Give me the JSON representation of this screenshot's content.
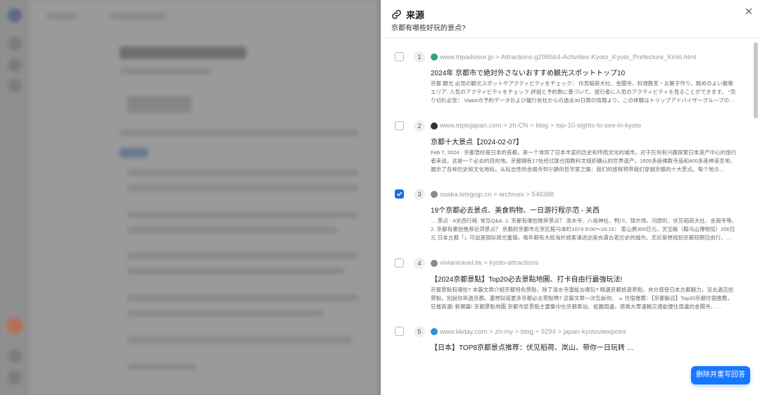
{
  "panel": {
    "title": "来源",
    "subtitle": "京都有哪些好玩的景点?",
    "delete_button": "删除并重写回答"
  },
  "sources": [
    {
      "index": "1",
      "checked": false,
      "favicon": "tripadvisor-icon",
      "favicon_color": "#34a374",
      "url": "www.tripadvisor.jp > Attractions-g298564-Activities-Kyoto_Kyoto_Prefecture_Kinki.html",
      "title": "2024年 京都市で絶対外さないおすすめ観光スポットトップ10",
      "snippet": "京都 観光 必見の観光スポットやアクティビティをチェック： 伏見稲荷大社、金閣寺、料理教室・お菓子作り、眺めのよい散策エリア. 人気のアクティビティをチェック 評価と予約数に基づいて、旅行者に人気のアクティビティを見ることができます。 *売り切れ必至： Viatorの予約データおよび催行会社からの過去30日間の情報より、この体験はトリップアドバイザーグループの…"
    },
    {
      "index": "2",
      "checked": false,
      "favicon": "triptojapan-icon",
      "favicon_color": "#333333",
      "url": "www.triptojapan.com > zh-CN > blog > top-10-sights-to-see-in-kyoto",
      "title": "京都十大景点【2024-02-07】",
      "snippet": "Feb 7, 2024 · 京都曾经是日本的首都。是一个体现了日本丰富的历史和传统文化的城市。对于任何有兴趣探索日本遗产中心的旅行者来说，这是一个必去的目的地。京都拥有17处经过联合国教科文组织确认的世界遗产，1600多座佛教寺庙和400多座神道圣地，展示了各种历史和文化地标。从标志性的金阁寺到宁静的哲学家之路：我们的旅程将带我们穿越京都的十大景点。每个地方…"
    },
    {
      "index": "3",
      "checked": true,
      "favicon": "letsgojp-icon",
      "favicon_color": "#8a8a8a",
      "url": "osaka.letsgojp.cn > archives > 548388",
      "title": "19个京都必去景点、美食购物、一日游行程示范 - 关西",
      "snippet": "… 景点 · #关西行程. 常见Q&A. 1. 京都有哪些推荐景点？ 清水寺、八坂神社、鸭川、锦市场、河原町、伏见稻荷大社、金阁寺等。 2. 京都有哪些推荐近郊景点？ 京都府京都市左京区鞍马本町1074 9:00～16:15： 爱山费300日元、灵宝殿（鞍马山博物馆）200日元 日本古都「」可说是国际观光重镇，每年都有大批海外旅客涌进这座充满古老历史的城市。无论是想规划京都短期自由行、…"
    },
    {
      "index": "4",
      "checked": false,
      "favicon": "viviantravel-icon",
      "favicon_color": "#8a8a8a",
      "url": "viviantravel.tw > kyoto-attractions",
      "title": "【2024京都景點】Top20必去景點地圖、打卡自由行最強玩法!",
      "snippet": "京都景點有哪些? 本篇文章介紹京都特色景點，除了清水寺還能去哪玩? 精選京都旅遊景點，充分感受日本古都魅力，沒去過這些景點，別說你來過京都。還想知道更多京都必去景點嗎? 這篇文章一次告訴你。 ☕ 住宿推薦：【京都飯店】Top30京都住宿推薦，狂推首選! 新開幕! 京都景點地圖 京都市區景點主要集中在京都車站、祇園周邊，搭乘大眾運輸交通能便往周邊的金閣寺、…"
    },
    {
      "index": "5",
      "checked": false,
      "favicon": "kkday-icon",
      "favicon_color": "#2d8fd5",
      "url": "www.kkday.com > zh-my > blog > 9294 > japan-kyotoviewpoint",
      "title": "【日本】TOP8京都景点推荐：伏见稻荷、岚山、带你一日玩转 …",
      "snippet": ""
    }
  ]
}
